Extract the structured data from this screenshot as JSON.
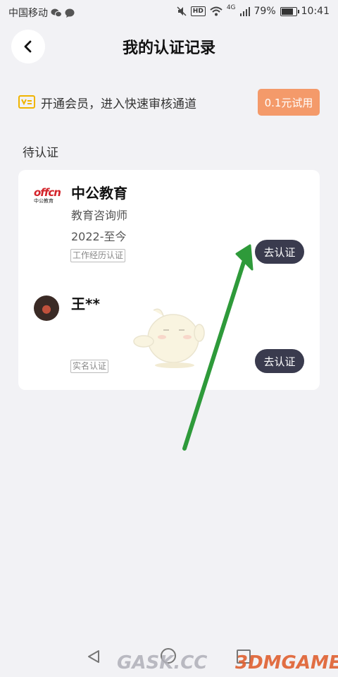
{
  "status_bar": {
    "carrier": "中国移动",
    "network": "4G",
    "battery": "79%",
    "time": "10:41",
    "hd": "HD"
  },
  "header": {
    "title": "我的认证记录",
    "back_icon": "chevron-left-icon"
  },
  "vip_banner": {
    "icon": "vip-card-icon",
    "text": "开通会员，进入快速审核通道",
    "button_label": "0.1元试用",
    "accent_color": "#f49a6a",
    "icon_color": "#f0b400"
  },
  "section": {
    "title": "待认证"
  },
  "records": [
    {
      "logo_text": "offcn",
      "logo_subtext": "中公教育",
      "name": "中公教育",
      "position": "教育咨询师",
      "period": "2022-至今",
      "tag": "工作经历认证",
      "button_label": "去认证"
    },
    {
      "name": "王**",
      "tag": "实名认证",
      "button_label": "去认证"
    }
  ],
  "watermark": {
    "left_text": "GASK.CC",
    "right_text": "3DMGAME"
  },
  "colors": {
    "background": "#f2f2f5",
    "card": "#ffffff",
    "verify_button": "#3a3b4e",
    "annotation_arrow": "#2e9a3a"
  }
}
